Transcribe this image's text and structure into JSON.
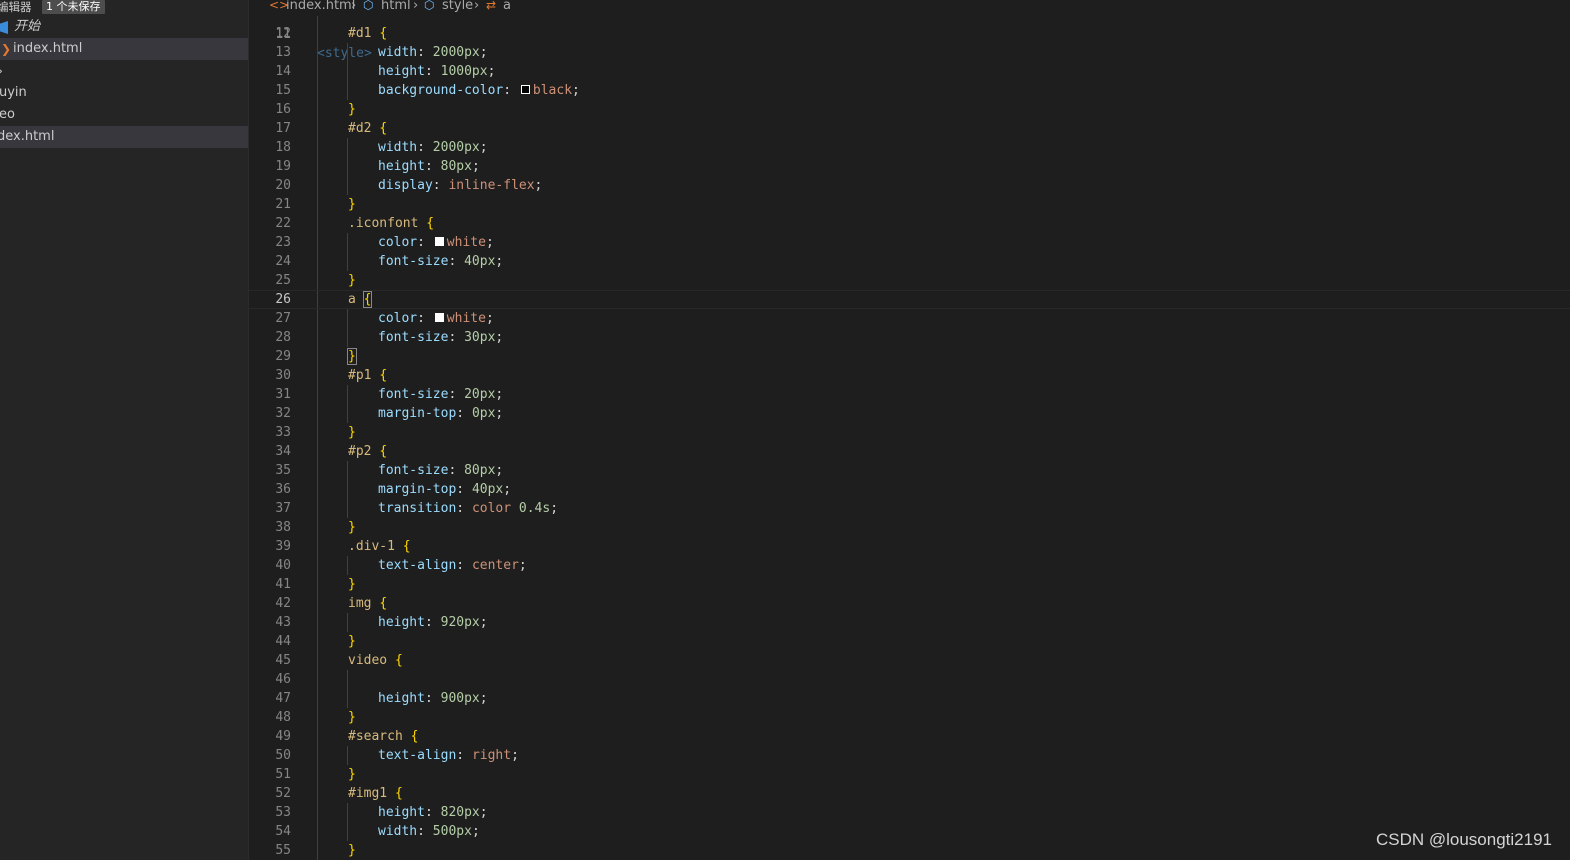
{
  "sidebar": {
    "header_title": "编辑器",
    "unsaved_badge": "1 个未保存",
    "items": [
      {
        "label": "开始"
      },
      {
        "label": "index.html"
      },
      {
        "label": ""
      },
      {
        "label": "uyin"
      },
      {
        "label": "eo"
      },
      {
        "label": "dex.html"
      }
    ]
  },
  "breadcrumb": {
    "file": "index.html",
    "html": "html",
    "style": "style",
    "a": "a"
  },
  "editor": {
    "partial_top_line": "<style>",
    "partial_top_number": "11",
    "current_line": "26",
    "lines": [
      {
        "n": "12",
        "text": "#d1 {"
      },
      {
        "n": "13",
        "text": "width: 2000px;"
      },
      {
        "n": "14",
        "text": "height: 1000px;"
      },
      {
        "n": "15",
        "text": "background-color: black;"
      },
      {
        "n": "16",
        "text": "}"
      },
      {
        "n": "17",
        "text": "#d2 {"
      },
      {
        "n": "18",
        "text": "width: 2000px;"
      },
      {
        "n": "19",
        "text": "height: 80px;"
      },
      {
        "n": "20",
        "text": "display: inline-flex;"
      },
      {
        "n": "21",
        "text": "}"
      },
      {
        "n": "22",
        "text": ".iconfont {"
      },
      {
        "n": "23",
        "text": "color: white;"
      },
      {
        "n": "24",
        "text": "font-size: 40px;"
      },
      {
        "n": "25",
        "text": "}"
      },
      {
        "n": "26",
        "text": "a {"
      },
      {
        "n": "27",
        "text": "color: white;"
      },
      {
        "n": "28",
        "text": "font-size: 30px;"
      },
      {
        "n": "29",
        "text": "}"
      },
      {
        "n": "30",
        "text": "#p1 {"
      },
      {
        "n": "31",
        "text": "font-size: 20px;"
      },
      {
        "n": "32",
        "text": "margin-top: 0px;"
      },
      {
        "n": "33",
        "text": "}"
      },
      {
        "n": "34",
        "text": "#p2 {"
      },
      {
        "n": "35",
        "text": "font-size: 80px;"
      },
      {
        "n": "36",
        "text": "margin-top: 40px;"
      },
      {
        "n": "37",
        "text": "transition: color 0.4s;"
      },
      {
        "n": "38",
        "text": "}"
      },
      {
        "n": "39",
        "text": ".div-1 {"
      },
      {
        "n": "40",
        "text": "text-align: center;"
      },
      {
        "n": "41",
        "text": "}"
      },
      {
        "n": "42",
        "text": "img {"
      },
      {
        "n": "43",
        "text": "height: 920px;"
      },
      {
        "n": "44",
        "text": "}"
      },
      {
        "n": "45",
        "text": "video {"
      },
      {
        "n": "46",
        "text": ""
      },
      {
        "n": "47",
        "text": "height: 900px;"
      },
      {
        "n": "48",
        "text": "}"
      },
      {
        "n": "49",
        "text": "#search {"
      },
      {
        "n": "50",
        "text": "text-align: right;"
      },
      {
        "n": "51",
        "text": "}"
      },
      {
        "n": "52",
        "text": "#img1 {"
      },
      {
        "n": "53",
        "text": "height: 820px;"
      },
      {
        "n": "54",
        "text": "width: 500px;"
      },
      {
        "n": "55",
        "text": "}"
      }
    ]
  },
  "watermark": "CSDN @lousongti2191",
  "colors": {
    "selector": "#d7ba7d",
    "property": "#9cdcfe",
    "number": "#b5cea8",
    "value": "#ce9178",
    "bracket": "#ffd700"
  }
}
